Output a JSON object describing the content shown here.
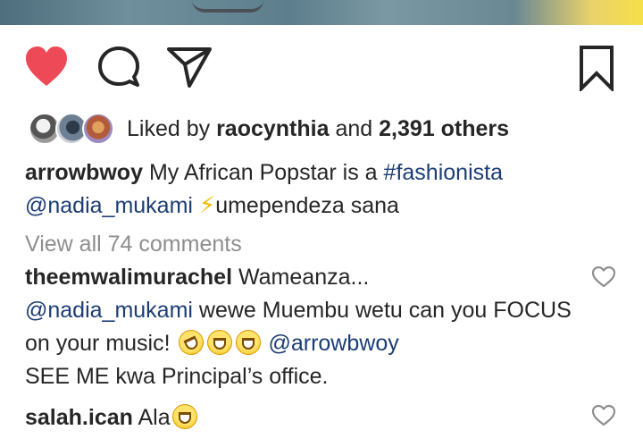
{
  "post": {
    "liked_by": {
      "prefix": "Liked by",
      "user": "raocynthia",
      "and": "and",
      "others": "2,391 others"
    },
    "caption": {
      "username": "arrowbwoy",
      "text_1": "My African Popstar is a",
      "hashtag": "#fashionista",
      "mention": "@nadia_mukami",
      "emoji": "⚡",
      "text_2": "umependeza sana"
    },
    "view_all_comments": "View all 74 comments",
    "comments": [
      {
        "username": "theemwalimurachel",
        "text_1": "Wameanza...",
        "mention_1": "@nadia_mukami",
        "text_2": "wewe Muembu wetu can you FOCUS on your music!",
        "emoji": [
          "rolling-on-floor-laughing",
          "grinning-squinting",
          "grinning-squinting"
        ],
        "mention_2": "@arrowbwoy",
        "text_3": "SEE ME kwa Principal’s office."
      },
      {
        "username": "salah.ican",
        "text_1": "Ala",
        "emoji": [
          "grinning-squinting"
        ]
      }
    ]
  },
  "icons": {
    "like": "heart-filled-icon",
    "comment": "speech-bubble-icon",
    "share": "paper-plane-icon",
    "save": "bookmark-icon",
    "comment_like": "heart-outline-icon"
  },
  "colors": {
    "like_red": "#ed4956",
    "link_blue": "#1c3d74",
    "text": "#262626",
    "muted": "#8e8e8e"
  }
}
